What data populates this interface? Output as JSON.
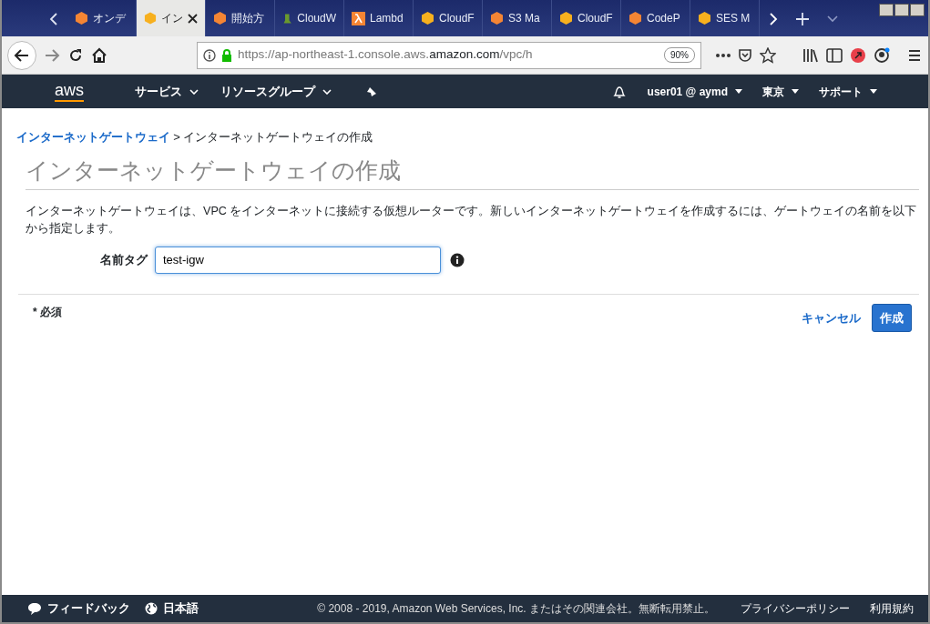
{
  "browser": {
    "tabs": [
      {
        "label": "オンデ",
        "selected": false,
        "kind": "cube",
        "color": "#f58534"
      },
      {
        "label": "イン",
        "selected": true,
        "kind": "cube",
        "color": "#f7b01e"
      },
      {
        "label": "開始方",
        "selected": false,
        "kind": "cube",
        "color": "#f58534"
      },
      {
        "label": "CloudW",
        "selected": false,
        "kind": "stack",
        "color": "#6a9a2d"
      },
      {
        "label": "Lambd",
        "selected": false,
        "kind": "lambda",
        "color": "#f58534"
      },
      {
        "label": "CloudF",
        "selected": false,
        "kind": "cube",
        "color": "#f7b01e"
      },
      {
        "label": "S3 Ma",
        "selected": false,
        "kind": "cube",
        "color": "#f58534"
      },
      {
        "label": "CloudF",
        "selected": false,
        "kind": "cube",
        "color": "#f7b01e"
      },
      {
        "label": "CodeP",
        "selected": false,
        "kind": "cube",
        "color": "#f58534"
      },
      {
        "label": "SES M",
        "selected": false,
        "kind": "cube",
        "color": "#f7b01e"
      }
    ],
    "url_prefix": "https://ap-northeast-1.console.aws.",
    "url_domain": "amazon.com",
    "url_suffix": "/vpc/h",
    "zoom": "90%"
  },
  "aws_nav": {
    "logo": "aws",
    "services": "サービス",
    "resource_groups": "リソースグループ",
    "user": "user01 @ aymd",
    "region": "東京",
    "support": "サポート"
  },
  "breadcrumb": [
    {
      "label": "インターネットゲートウェイ",
      "kind": "link"
    },
    {
      "label": "インターネットゲートウェイの作成",
      "kind": "text"
    }
  ],
  "breadcrumb_separator": ">",
  "page_title": "インターネットゲートウェイの作成",
  "description": "インターネットゲートウェイは、VPC をインターネットに接続する仮想ルーターです。新しいインターネットゲートウェイを作成するには、ゲートウェイの名前を以下から指定します。",
  "form": {
    "label": "名前タグ",
    "value": "test-igw",
    "focused": true
  },
  "required_note": "* 必須",
  "buttons": {
    "cancel": "キャンセル",
    "create": "作成"
  },
  "footer": {
    "feedback": "フィードバック",
    "language": "日本語",
    "copyright": "© 2008 - 2019, Amazon Web Services, Inc. またはその関連会社。無断転用禁止。",
    "privacy": "プライバシーポリシー",
    "terms": "利用規約"
  }
}
